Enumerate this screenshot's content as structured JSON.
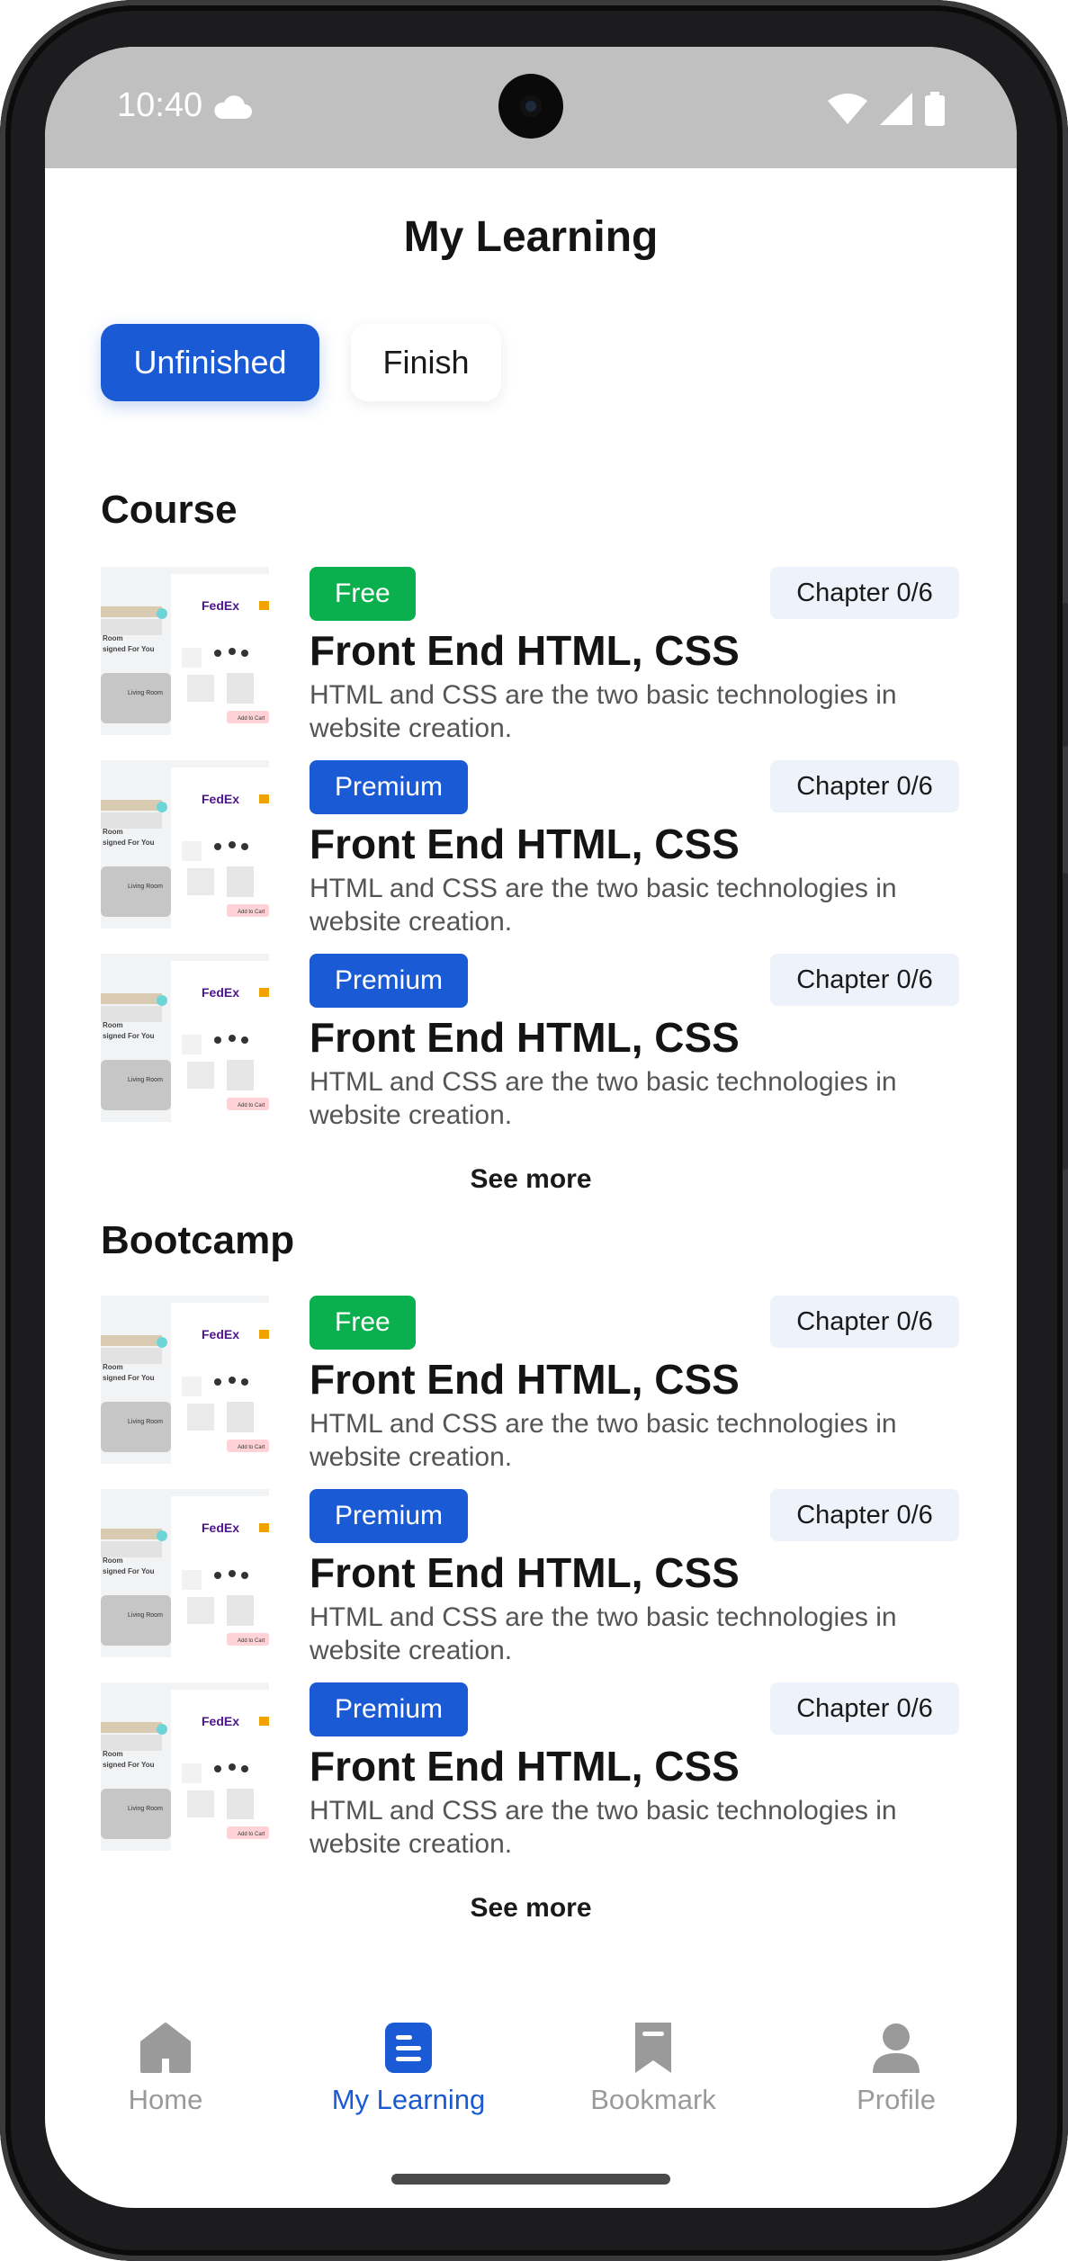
{
  "status_bar": {
    "time": "10:40"
  },
  "header": {
    "title": "My Learning"
  },
  "tabs": [
    {
      "label": "Unfinished",
      "active": true
    },
    {
      "label": "Finish",
      "active": false
    }
  ],
  "course": {
    "heading": "Course",
    "see_more": "See more",
    "items": [
      {
        "badge": "Free",
        "chapter": "Chapter 0/6",
        "title": "Front End HTML, CSS",
        "description": "HTML and CSS are the two basic technologies in website creation."
      },
      {
        "badge": "Premium",
        "chapter": "Chapter 0/6",
        "title": "Front End HTML, CSS",
        "description": "HTML and CSS are the two basic technologies in website creation."
      },
      {
        "badge": "Premium",
        "chapter": "Chapter 0/6",
        "title": "Front End HTML, CSS",
        "description": "HTML and CSS are the two basic technologies in website creation."
      }
    ]
  },
  "bootcamp": {
    "heading": "Bootcamp",
    "see_more": "See more",
    "items": [
      {
        "badge": "Free",
        "chapter": "Chapter 0/6",
        "title": "Front End HTML, CSS",
        "description": "HTML and CSS are the two basic technologies in website creation."
      },
      {
        "badge": "Premium",
        "chapter": "Chapter 0/6",
        "title": "Front End HTML, CSS",
        "description": "HTML and CSS are the two basic technologies in website creation."
      },
      {
        "badge": "Premium",
        "chapter": "Chapter 0/6",
        "title": "Front End HTML, CSS",
        "description": "HTML and CSS are the two basic technologies in website creation."
      }
    ]
  },
  "thumbnail": {
    "brand": "FedEx",
    "caption": "Living Room",
    "headline_a": "Room",
    "headline_b": "signed For You",
    "cart": "Add to Cart"
  },
  "bottom_nav": [
    {
      "label": "Home",
      "icon": "home-icon",
      "active": false
    },
    {
      "label": "My Learning",
      "icon": "learning-icon",
      "active": true
    },
    {
      "label": "Bookmark",
      "icon": "bookmark-icon",
      "active": false
    },
    {
      "label": "Profile",
      "icon": "profile-icon",
      "active": false
    }
  ],
  "colors": {
    "primary": "#1a5ad4",
    "free": "#0bb04e",
    "chapter_bg": "#eef2fb",
    "inactive": "#9a9a9a"
  }
}
